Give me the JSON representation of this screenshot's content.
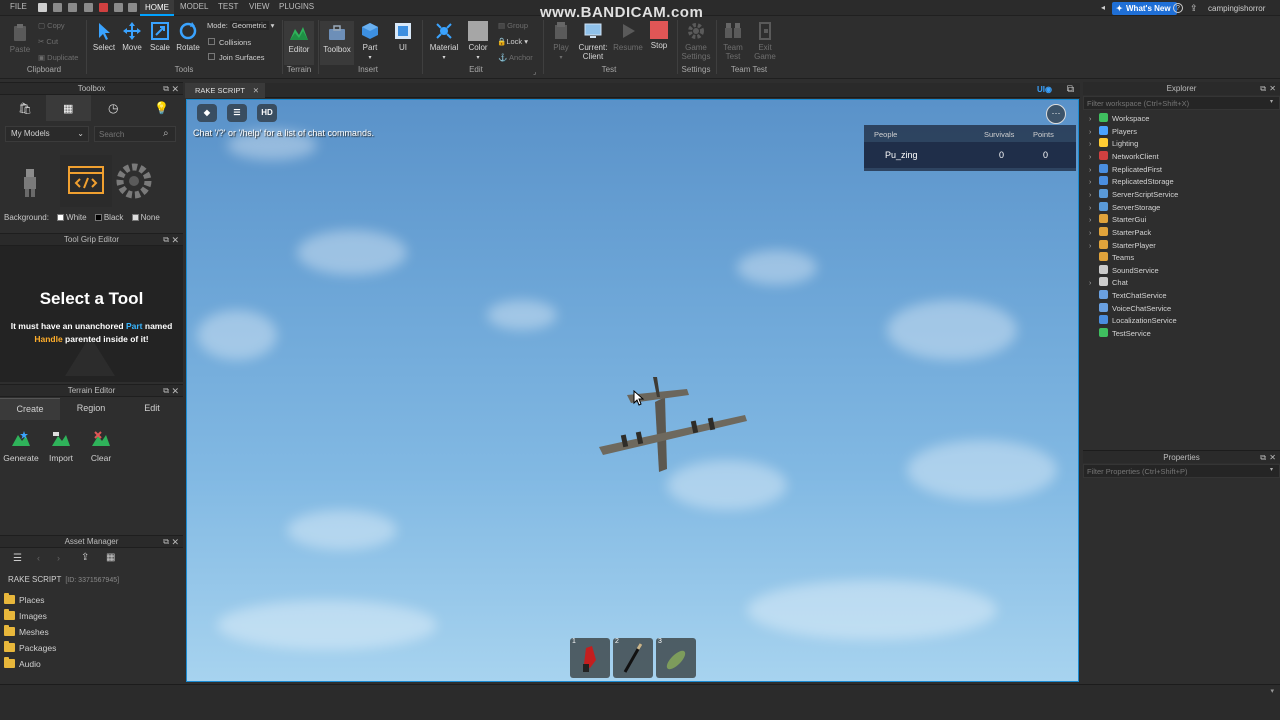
{
  "menubar": {
    "file": "FILE",
    "tabs": [
      "HOME",
      "MODEL",
      "TEST",
      "VIEW",
      "PLUGINS"
    ],
    "watermark": "www.BANDICAM.com",
    "whats_new": "What's New",
    "username": "campingishorror"
  },
  "ribbon": {
    "clipboard": {
      "paste": "Paste",
      "copy": "Copy",
      "cut": "Cut",
      "duplicate": "Duplicate",
      "label": "Clipboard"
    },
    "tools": {
      "select": "Select",
      "move": "Move",
      "scale": "Scale",
      "rotate": "Rotate",
      "mode_label": "Mode:",
      "mode_value": "Geometric",
      "collisions": "Collisions",
      "join_surfaces": "Join Surfaces",
      "label": "Tools"
    },
    "terrain": {
      "editor": "Editor",
      "label": "Terrain"
    },
    "insert": {
      "toolbox": "Toolbox",
      "part": "Part",
      "ui": "UI",
      "label": "Insert"
    },
    "edit": {
      "material": "Material",
      "color": "Color",
      "group": "Group",
      "lock": "Lock",
      "anchor": "Anchor",
      "label": "Edit"
    },
    "test": {
      "play": "Play",
      "current_client_1": "Current:",
      "current_client_2": "Client",
      "resume": "Resume",
      "stop": "Stop",
      "label": "Test"
    },
    "settings": {
      "game_settings_1": "Game",
      "game_settings_2": "Settings",
      "label": "Settings"
    },
    "team_test": {
      "team_test_1": "Team",
      "team_test_2": "Test",
      "exit_game_1": "Exit",
      "exit_game_2": "Game",
      "label": "Team Test"
    }
  },
  "toolbox": {
    "title": "Toolbox",
    "category": "My Models",
    "search_placeholder": "Search",
    "background_label": "Background:",
    "bg_options": [
      "White",
      "Black",
      "None"
    ]
  },
  "tool_grip_editor": {
    "title": "Tool Grip Editor",
    "heading": "Select a Tool",
    "desc_1": "It must have an unanchored ",
    "desc_part": "Part",
    "desc_2": " named",
    "desc_handle": "Handle",
    "desc_3": " parented inside of it!"
  },
  "terrain_editor": {
    "title": "Terrain Editor",
    "tabs": [
      "Create",
      "Region",
      "Edit"
    ],
    "buttons": [
      "Generate",
      "Import",
      "Clear"
    ]
  },
  "asset_manager": {
    "title": "Asset Manager",
    "place_name": "RAKE SCRIPT",
    "place_id": "[ID: 3371567945]",
    "folders": [
      "Places",
      "Images",
      "Meshes",
      "Packages",
      "Audio"
    ]
  },
  "viewport": {
    "tab_title": "RAKE SCRIPT",
    "hd_label": "HD",
    "chat_hint": "Chat '/?' or '/help' for a list of chat commands.",
    "leaderboard": {
      "headers": [
        "People",
        "Survivals",
        "Points"
      ],
      "rows": [
        {
          "name": "Pu_zing",
          "survivals": "0",
          "points": "0"
        }
      ]
    },
    "hotbar": [
      "1",
      "2",
      "3"
    ]
  },
  "explorer": {
    "title": "Explorer",
    "filter_placeholder": "Filter workspace (Ctrl+Shift+X)",
    "items": [
      {
        "label": "Workspace",
        "expandable": true,
        "color": "#3fbf5f"
      },
      {
        "label": "Players",
        "expandable": true,
        "color": "#4aa3ff"
      },
      {
        "label": "Lighting",
        "expandable": true,
        "color": "#ffcc33"
      },
      {
        "label": "NetworkClient",
        "expandable": true,
        "color": "#d04040"
      },
      {
        "label": "ReplicatedFirst",
        "expandable": true,
        "color": "#4a8ee0"
      },
      {
        "label": "ReplicatedStorage",
        "expandable": true,
        "color": "#4a8ee0"
      },
      {
        "label": "ServerScriptService",
        "expandable": true,
        "color": "#5a9ad8"
      },
      {
        "label": "ServerStorage",
        "expandable": true,
        "color": "#5a9ad8"
      },
      {
        "label": "StarterGui",
        "expandable": true,
        "color": "#e0a33b"
      },
      {
        "label": "StarterPack",
        "expandable": true,
        "color": "#e0a33b"
      },
      {
        "label": "StarterPlayer",
        "expandable": true,
        "color": "#e0a33b"
      },
      {
        "label": "Teams",
        "expandable": false,
        "color": "#e0a33b"
      },
      {
        "label": "SoundService",
        "expandable": false,
        "color": "#cccccc"
      },
      {
        "label": "Chat",
        "expandable": true,
        "color": "#cccccc"
      },
      {
        "label": "TextChatService",
        "expandable": false,
        "color": "#6aa0e0"
      },
      {
        "label": "VoiceChatService",
        "expandable": false,
        "color": "#6aa0e0"
      },
      {
        "label": "LocalizationService",
        "expandable": false,
        "color": "#4a8ee0"
      },
      {
        "label": "TestService",
        "expandable": false,
        "color": "#3fbf5f"
      }
    ]
  },
  "properties": {
    "title": "Properties",
    "filter_placeholder": "Filter Properties (Ctrl+Shift+P)"
  }
}
